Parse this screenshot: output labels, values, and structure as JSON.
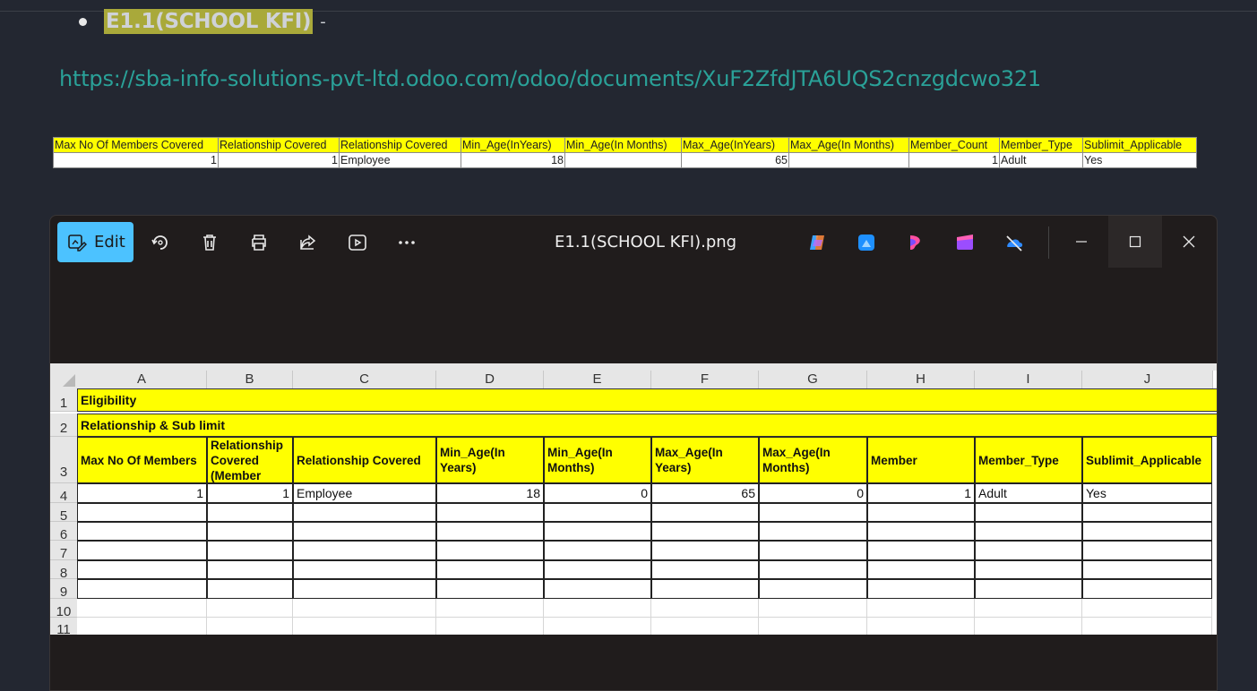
{
  "doc": {
    "bullet_title": "E1.1(SCHOOL KFI)",
    "bullet_dash": "-",
    "link": "https://sba-info-solutions-pvt-ltd.odoo.com/odoo/documents/XuF2ZfdJTA6UQS2cnzgdcwo321"
  },
  "mini_table": {
    "headers": [
      "Max No Of Members Covered",
      "Relationship Covered",
      "Relationship Covered",
      "Min_Age(InYears)",
      "Min_Age(In Months)",
      "Max_Age(InYears)",
      "Max_Age(In Months)",
      "Member_Count",
      "Member_Type",
      "Sublimit_Applicable"
    ],
    "row": [
      "1",
      "1",
      "Employee",
      "18",
      "",
      "65",
      "",
      "1",
      "Adult",
      "Yes"
    ]
  },
  "viewer": {
    "edit_label": "Edit",
    "file_title": "E1.1(SCHOOL KFI).png",
    "accent": "#4cc2ff"
  },
  "sheet": {
    "columns": [
      "A",
      "B",
      "C",
      "D",
      "E",
      "F",
      "G",
      "H",
      "I",
      "J"
    ],
    "rows": [
      "1",
      "2",
      "3",
      "4",
      "5",
      "6",
      "7",
      "8",
      "9",
      "10",
      "11"
    ],
    "row1": "Eligibility",
    "row2": "Relationship & Sub limit",
    "headers": [
      "Max No Of Members",
      "Relationship Covered (Member",
      "Relationship Covered",
      "Min_Age(In Years)",
      "Min_Age(In Months)",
      "Max_Age(In Years)",
      "Max_Age(In Months)",
      "Member",
      "Member_Type",
      "Sublimit_Applicable"
    ],
    "data": [
      "1",
      "1",
      "Employee",
      "18",
      "0",
      "65",
      "0",
      "1",
      "Adult",
      "Yes"
    ]
  }
}
